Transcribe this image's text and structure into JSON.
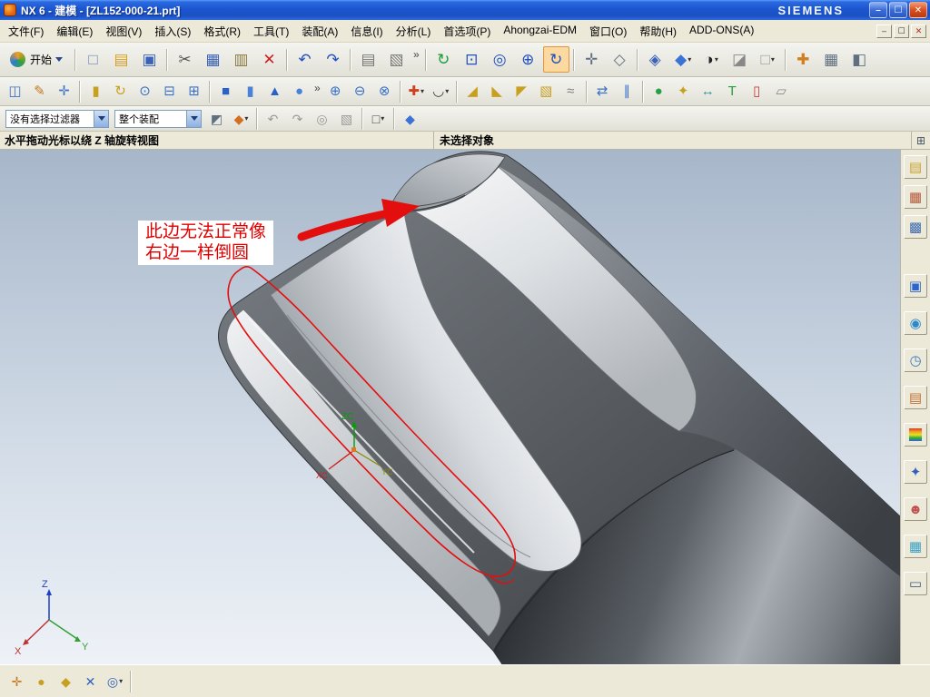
{
  "window": {
    "title": "NX 6 - 建模 - [ZL152-000-21.prt]",
    "brand": "SIEMENS",
    "controls": {
      "minimize": "–",
      "maximize": "☐",
      "close": "✕"
    }
  },
  "menu": {
    "items": [
      {
        "name": "menu-file",
        "label": "文件(F)"
      },
      {
        "name": "menu-edit",
        "label": "编辑(E)"
      },
      {
        "name": "menu-view",
        "label": "视图(V)"
      },
      {
        "name": "menu-insert",
        "label": "插入(S)"
      },
      {
        "name": "menu-format",
        "label": "格式(R)"
      },
      {
        "name": "menu-tools",
        "label": "工具(T)"
      },
      {
        "name": "menu-assemblies",
        "label": "装配(A)"
      },
      {
        "name": "menu-information",
        "label": "信息(I)"
      },
      {
        "name": "menu-analysis",
        "label": "分析(L)"
      },
      {
        "name": "menu-preferences",
        "label": "首选项(P)"
      },
      {
        "name": "menu-ahongzai-edm",
        "label": "Ahongzai-EDM"
      },
      {
        "name": "menu-window",
        "label": "窗口(O)"
      },
      {
        "name": "menu-help",
        "label": "帮助(H)"
      },
      {
        "name": "menu-addons",
        "label": "ADD-ONS(A)"
      }
    ],
    "child_controls": {
      "minimize": "–",
      "restore": "☐",
      "close": "✕"
    }
  },
  "toolbars": {
    "dropdown_glyph": "▾",
    "overflow_glyph": "»",
    "start": {
      "label": "开始"
    },
    "standard": [
      {
        "type": "sep"
      },
      {
        "name": "new-file-icon",
        "glyph": "□",
        "color": "#6a86b8"
      },
      {
        "name": "open-icon",
        "glyph": "▤",
        "color": "#d8a020"
      },
      {
        "name": "save-icon",
        "glyph": "▣",
        "color": "#3a62b8"
      },
      {
        "type": "sep"
      },
      {
        "name": "cut-icon",
        "glyph": "✂",
        "color": "#555555"
      },
      {
        "name": "copy-icon",
        "glyph": "▦",
        "color": "#3a62b8"
      },
      {
        "name": "paste-icon",
        "glyph": "▥",
        "color": "#8a7a40"
      },
      {
        "name": "delete-icon",
        "glyph": "✕",
        "color": "#cc2020"
      },
      {
        "type": "sep"
      },
      {
        "name": "undo-icon",
        "glyph": "↶",
        "color": "#2050c0"
      },
      {
        "name": "redo-icon",
        "glyph": "↷",
        "color": "#2050c0"
      },
      {
        "type": "sep"
      },
      {
        "name": "plot-icon",
        "glyph": "▤",
        "color": "#777777"
      },
      {
        "name": "clipboard-icon",
        "glyph": "▧",
        "color": "#777777"
      },
      {
        "type": "chevron"
      },
      {
        "type": "sep"
      },
      {
        "name": "refresh-view-icon",
        "glyph": "↻",
        "color": "#18a038"
      },
      {
        "name": "fit-view-icon",
        "glyph": "⊡",
        "color": "#2050c0"
      },
      {
        "name": "zoom-box-icon",
        "glyph": "◎",
        "color": "#2050c0"
      },
      {
        "name": "zoom-in-out-icon",
        "glyph": "⊕",
        "color": "#2050c0"
      },
      {
        "name": "rotate-view-icon",
        "glyph": "↻",
        "color": "#2050c0",
        "active": true
      },
      {
        "type": "sep"
      },
      {
        "name": "pan-view-icon",
        "glyph": "✛",
        "color": "#607080"
      },
      {
        "name": "orient-view-icon",
        "glyph": "◇",
        "color": "#607080"
      },
      {
        "type": "sep"
      },
      {
        "name": "trimetric-view-icon",
        "glyph": "◈",
        "color": "#3a62b8"
      },
      {
        "name": "shaded-view-icon",
        "glyph": "◆",
        "color": "#3a72d8",
        "dropdown": true
      },
      {
        "name": "render-style-icon",
        "glyph": "◑",
        "color": "#222222",
        "dropdown": true
      },
      {
        "name": "face-analysis-icon",
        "glyph": "◪",
        "color": "#888888"
      },
      {
        "name": "background-icon",
        "glyph": "□",
        "color": "#999999",
        "dropdown": true
      },
      {
        "type": "sep"
      },
      {
        "name": "snap-point-icon",
        "glyph": "✚",
        "color": "#d08020"
      },
      {
        "name": "grid-icon",
        "glyph": "▦",
        "color": "#607080"
      },
      {
        "name": "wcs-display-icon",
        "glyph": "◧",
        "color": "#607080"
      }
    ],
    "features": [
      {
        "name": "datum-plane-icon",
        "glyph": "◫",
        "color": "#3a72c8"
      },
      {
        "name": "sketch-icon",
        "glyph": "✎",
        "color": "#c07820"
      },
      {
        "name": "datum-csys-icon",
        "glyph": "✛",
        "color": "#3a72c8"
      },
      {
        "type": "sep"
      },
      {
        "name": "extrude-icon",
        "glyph": "▮",
        "color": "#c8a020"
      },
      {
        "name": "revolve-icon",
        "glyph": "↻",
        "color": "#c8a020"
      },
      {
        "name": "hole-icon",
        "glyph": "⊙",
        "color": "#3a72c8"
      },
      {
        "name": "pocket-icon",
        "glyph": "⊟",
        "color": "#3a72c8"
      },
      {
        "name": "pad-icon",
        "glyph": "⊞",
        "color": "#3a72c8"
      },
      {
        "type": "sep"
      },
      {
        "name": "block-icon",
        "glyph": "■",
        "color": "#2a62c8"
      },
      {
        "name": "cylinder-icon",
        "glyph": "▮",
        "color": "#4a82d8"
      },
      {
        "name": "cone-icon",
        "glyph": "▲",
        "color": "#2a62c8"
      },
      {
        "name": "sphere-icon",
        "glyph": "●",
        "color": "#4a82d8"
      },
      {
        "type": "chevron"
      },
      {
        "name": "unite-icon",
        "glyph": "⊕",
        "color": "#3a72c8"
      },
      {
        "name": "subtract-icon",
        "glyph": "⊖",
        "color": "#3a72c8"
      },
      {
        "name": "intersect-icon",
        "glyph": "⊗",
        "color": "#3a72c8"
      },
      {
        "type": "sep"
      },
      {
        "name": "point-dialog-icon",
        "glyph": "✚",
        "color": "#d04020",
        "dropdown": true
      },
      {
        "name": "arc-icon",
        "glyph": "◡",
        "color": "#404040",
        "dropdown": true
      },
      {
        "type": "sep"
      },
      {
        "name": "edge-blend-icon",
        "glyph": "◢",
        "color": "#c8a020"
      },
      {
        "name": "chamfer-icon",
        "glyph": "◣",
        "color": "#c8a020"
      },
      {
        "name": "draft-icon",
        "glyph": "◤",
        "color": "#c8a020"
      },
      {
        "name": "shell-icon",
        "glyph": "▧",
        "color": "#c8a020"
      },
      {
        "name": "thread-icon",
        "glyph": "≈",
        "color": "#808080"
      },
      {
        "type": "sep"
      },
      {
        "name": "instance-feature-icon",
        "glyph": "⇄",
        "color": "#3a72c8"
      },
      {
        "name": "mirror-feature-icon",
        "glyph": "∥",
        "color": "#3a72c8"
      },
      {
        "type": "sep"
      },
      {
        "name": "hexagon-feature-icon",
        "glyph": "●",
        "color": "#28a048"
      },
      {
        "name": "reuse-feature-icon",
        "glyph": "✦",
        "color": "#c8a020"
      },
      {
        "name": "dimension-icon",
        "glyph": "↔",
        "color": "#2898a0"
      },
      {
        "name": "text-icon",
        "glyph": "T",
        "color": "#20a040"
      },
      {
        "name": "tube-icon",
        "glyph": "▯",
        "color": "#c04040"
      },
      {
        "name": "pipe-icon",
        "glyph": "▱",
        "color": "#888888"
      }
    ],
    "selection": {
      "filter_value": "没有选择过滤器",
      "scope_value": "整个装配",
      "icons": [
        {
          "name": "snap-toggle-icon",
          "glyph": "◩",
          "color": "#607080"
        },
        {
          "name": "general-selection-icon",
          "glyph": "◆",
          "color": "#d07020",
          "dropdown": true
        },
        {
          "type": "sep"
        },
        {
          "name": "previous-selection-icon",
          "glyph": "↶",
          "color": "#999999"
        },
        {
          "name": "restore-selection-icon",
          "glyph": "↷",
          "color": "#999999"
        },
        {
          "name": "capture-selection-icon",
          "glyph": "◎",
          "color": "#999999"
        },
        {
          "name": "highlight-selection-icon",
          "glyph": "▧",
          "color": "#999999"
        },
        {
          "type": "sep"
        },
        {
          "name": "marquee-select-icon",
          "glyph": "□",
          "color": "#404040",
          "dropdown": true
        },
        {
          "type": "sep"
        },
        {
          "name": "show-shaded-icon",
          "glyph": "◆",
          "color": "#3a72d8"
        }
      ]
    }
  },
  "prompt_bar": {
    "cue": "水平拖动光标以绕 Z 轴旋转视图",
    "status": "未选择对象",
    "button_glyph": "⊞"
  },
  "viewport": {
    "annotation": {
      "line1": "此边无法正常像",
      "line2": "右边一样倒圆"
    },
    "wcs": {
      "z": "ZC",
      "y": "YC",
      "x": "XC"
    },
    "triad": {
      "z": "Z",
      "y": "Y",
      "x": "X"
    }
  },
  "sidebar": {
    "items": [
      {
        "name": "sidebar-assembly-navigator-icon",
        "glyph": "▤",
        "color": "#c8a232"
      },
      {
        "name": "sidebar-constraint-navigator-icon",
        "glyph": "▦",
        "color": "#b05a3c",
        "gap": 6
      },
      {
        "name": "sidebar-part-navigator-icon",
        "glyph": "▩",
        "color": "#3c6ab0",
        "gap": 6
      },
      {
        "name": "sidebar-reuse-library-icon",
        "glyph": "▣",
        "color": "#2c66c8",
        "gap": 38
      },
      {
        "name": "sidebar-hd3d-tools-icon",
        "glyph": "◉",
        "color": "#2a8ad0",
        "gap": 14
      },
      {
        "name": "sidebar-history-icon",
        "glyph": "◷",
        "color": "#3a7ac0",
        "gap": 14
      },
      {
        "name": "sidebar-part-list-icon",
        "glyph": "▤",
        "color": "#c07030",
        "gap": 14
      },
      {
        "name": "sidebar-process-studio-icon",
        "glyph": "",
        "bg": "linear-gradient(180deg,#e03030,#e8a020,#f0e020,#30b030,#3060e0)",
        "gap": 14
      },
      {
        "name": "sidebar-wizards-icon",
        "glyph": "✦",
        "color": "#3060c0",
        "gap": 14
      },
      {
        "name": "sidebar-roles-icon",
        "glyph": "☻",
        "color": "#c05050",
        "gap": 14
      },
      {
        "name": "sidebar-system-scenes-icon",
        "glyph": "▦",
        "color": "#3aa0c8",
        "gap": 14
      },
      {
        "name": "sidebar-touch-panel-icon",
        "glyph": "▭",
        "color": "#406080",
        "gap": 14
      }
    ]
  },
  "bottom_bar": {
    "icons": [
      {
        "name": "snap-point-enable-icon",
        "glyph": "✛",
        "color": "#c87820"
      },
      {
        "name": "end-point-icon",
        "glyph": "●",
        "color": "#c8a020"
      },
      {
        "name": "mid-point-icon",
        "glyph": "◆",
        "color": "#c8a020"
      },
      {
        "name": "intersection-point-icon",
        "glyph": "✕",
        "color": "#3060c0"
      },
      {
        "name": "arc-center-icon",
        "glyph": "◎",
        "color": "#3060c0",
        "dropdown": true
      },
      {
        "type": "sep"
      }
    ]
  }
}
